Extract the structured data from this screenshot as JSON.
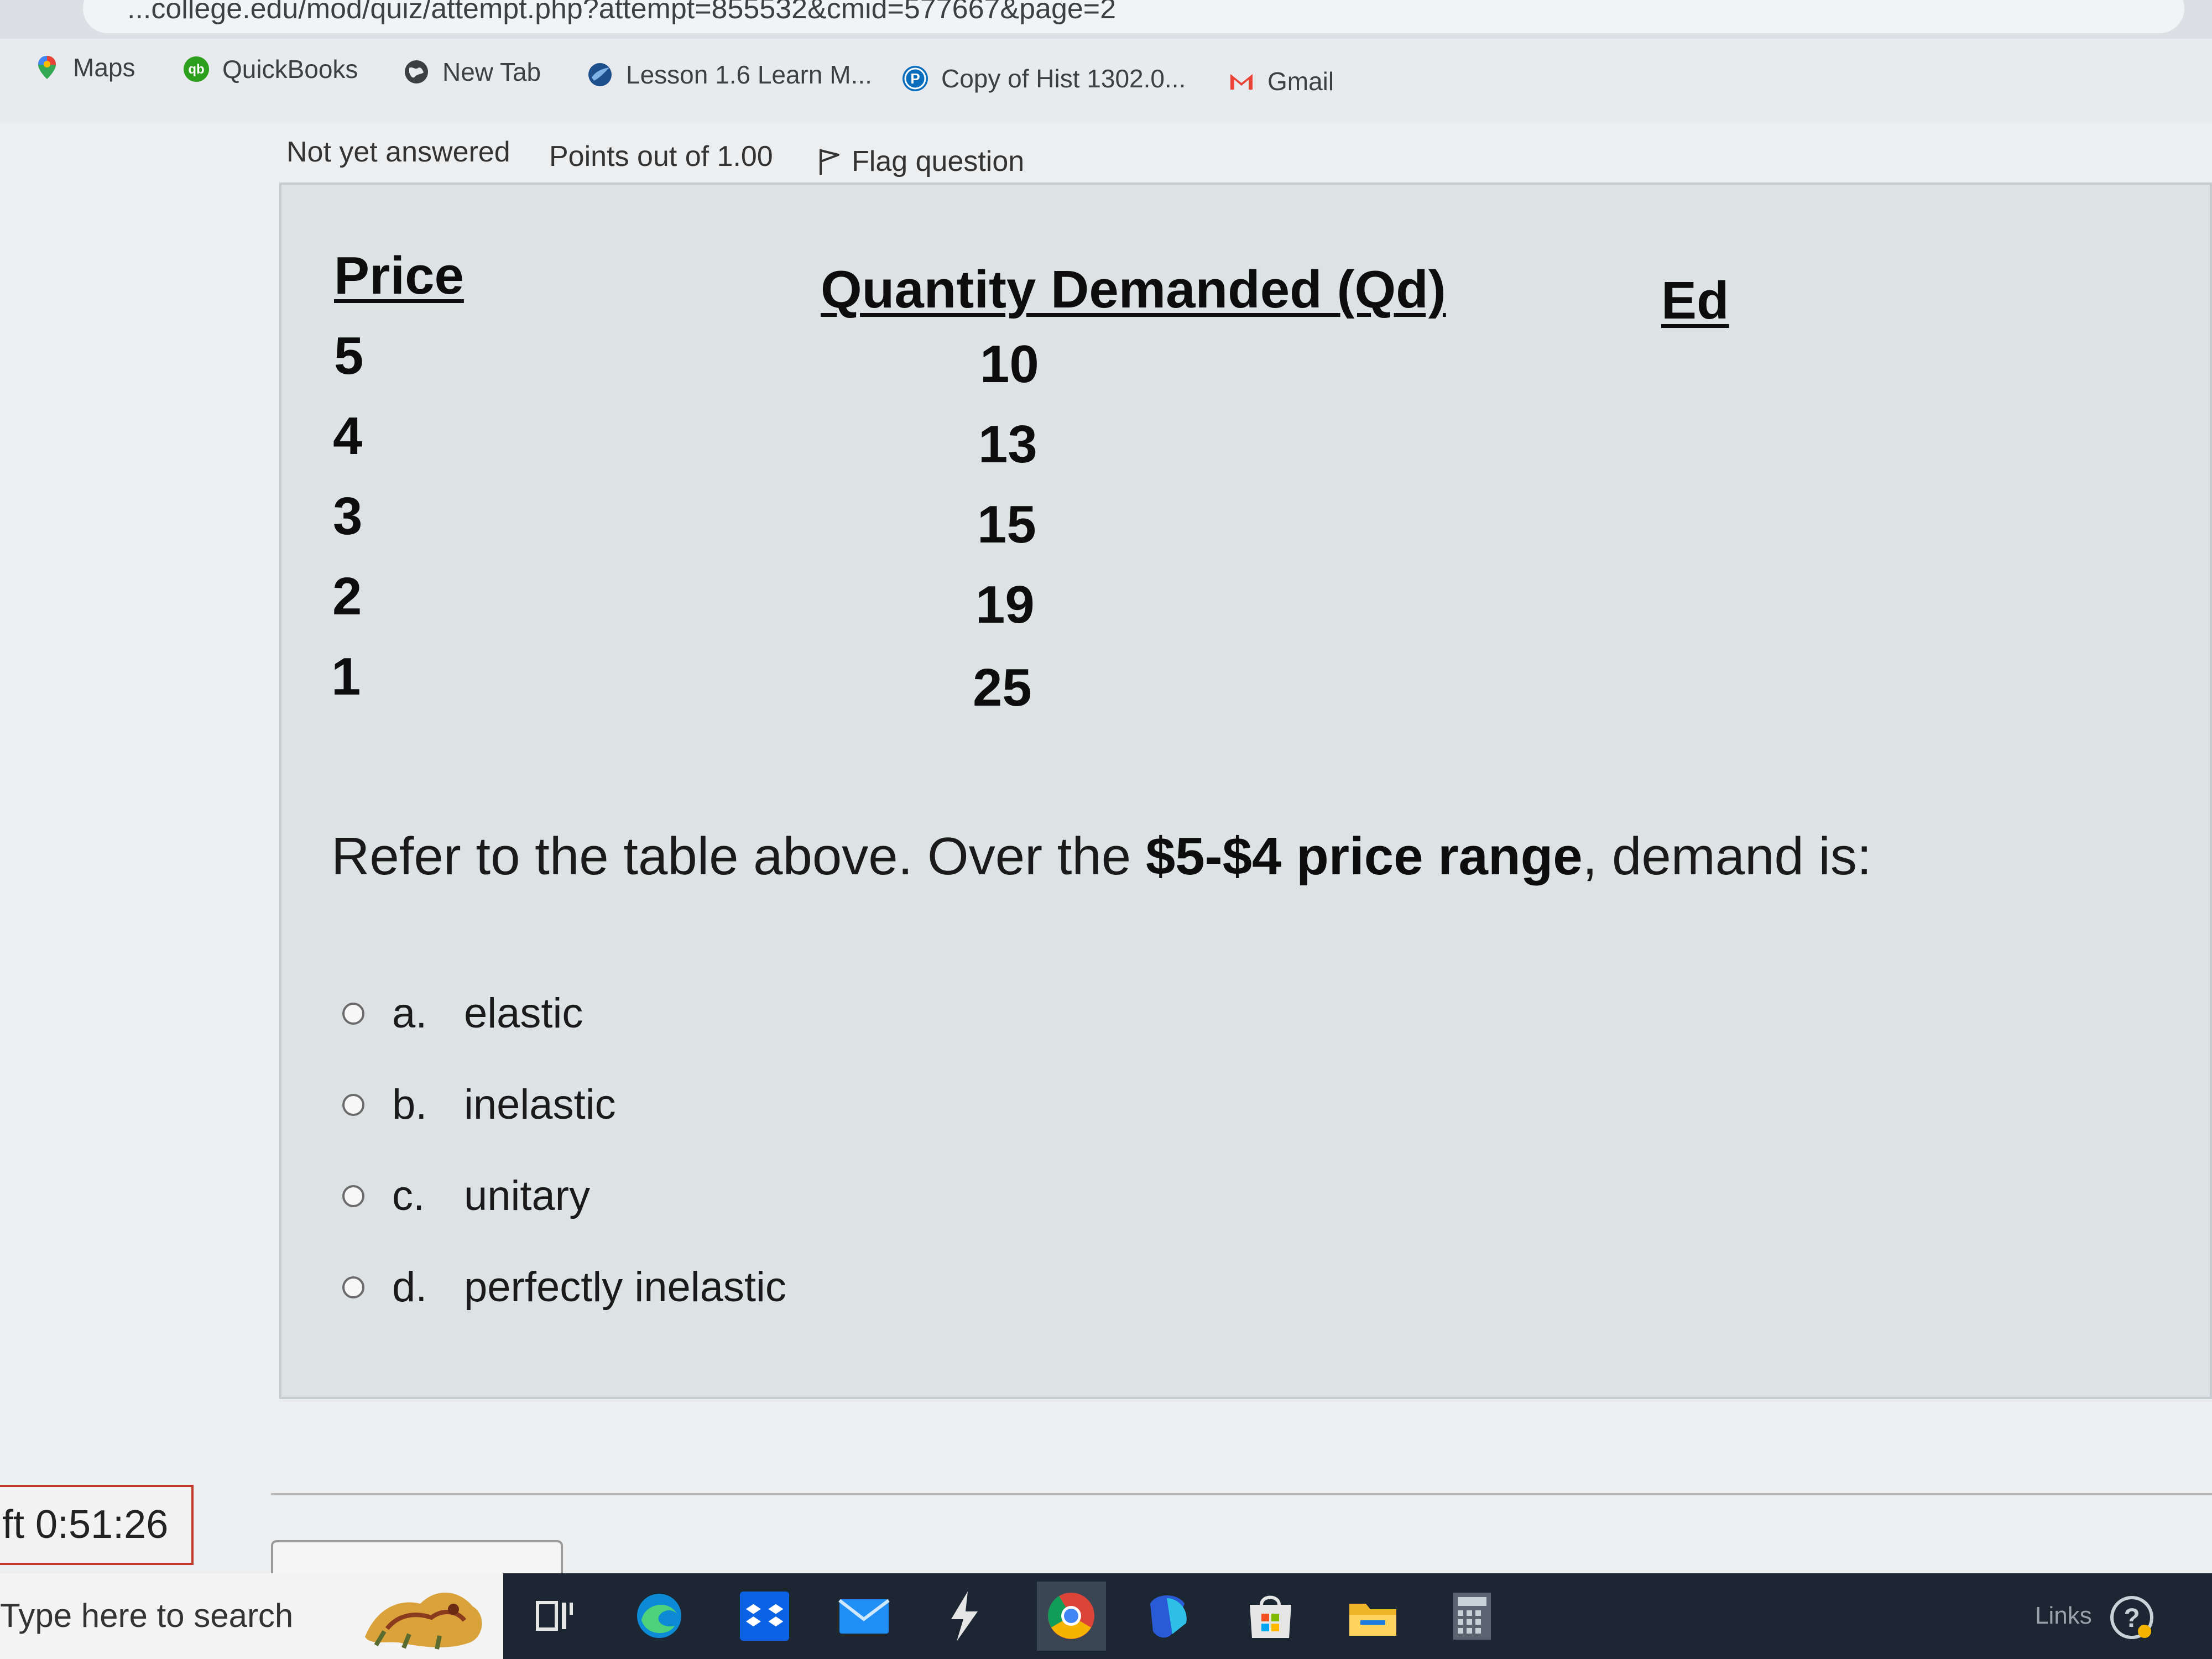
{
  "browser": {
    "url": "...college.edu/mod/quiz/attempt.php?attempt=855532&cmid=577667&page=2",
    "bookmarks": [
      {
        "label": "Maps",
        "icon": "maps-pin-icon"
      },
      {
        "label": "QuickBooks",
        "icon": "quickbooks-icon"
      },
      {
        "label": "New Tab",
        "icon": "globe-icon"
      },
      {
        "label": "Lesson 1.6 Learn M...",
        "icon": "lesson-site-icon"
      },
      {
        "label": "Copy of Hist 1302.0...",
        "icon": "pearson-icon"
      },
      {
        "label": "Gmail",
        "icon": "gmail-icon"
      }
    ]
  },
  "question_info": {
    "status": "Not yet answered",
    "points": "Points out of 1.00",
    "flag": "Flag question"
  },
  "table": {
    "headers": [
      "Price",
      "Quantity Demanded (Qd)",
      "Ed"
    ],
    "rows": [
      {
        "price": "5",
        "qd": "10"
      },
      {
        "price": "4",
        "qd": "13"
      },
      {
        "price": "3",
        "qd": "15"
      },
      {
        "price": "2",
        "qd": "19"
      },
      {
        "price": "1",
        "qd": "25"
      }
    ]
  },
  "question": {
    "prefix": "Refer to the table above. Over the ",
    "emphasis": "$5-$4 price range",
    "suffix": ", demand is:"
  },
  "options": [
    {
      "letter": "a.",
      "text": "elastic"
    },
    {
      "letter": "b.",
      "text": "inelastic"
    },
    {
      "letter": "c.",
      "text": "unitary"
    },
    {
      "letter": "d.",
      "text": "perfectly inelastic"
    }
  ],
  "timer": "ft 0:51:26",
  "taskbar": {
    "search_placeholder": "Type here to search",
    "apps": [
      "task-view-icon",
      "edge-icon",
      "dropbox-icon",
      "mail-icon",
      "lightning-app-icon",
      "chrome-icon",
      "copilot-icon",
      "store-icon",
      "file-explorer-icon",
      "calculator-icon"
    ],
    "links_label": "Links"
  },
  "colors": {
    "panel_bg": "#dde3e5",
    "taskbar_bg": "#1d2733",
    "timer_border": "#c0392b"
  }
}
